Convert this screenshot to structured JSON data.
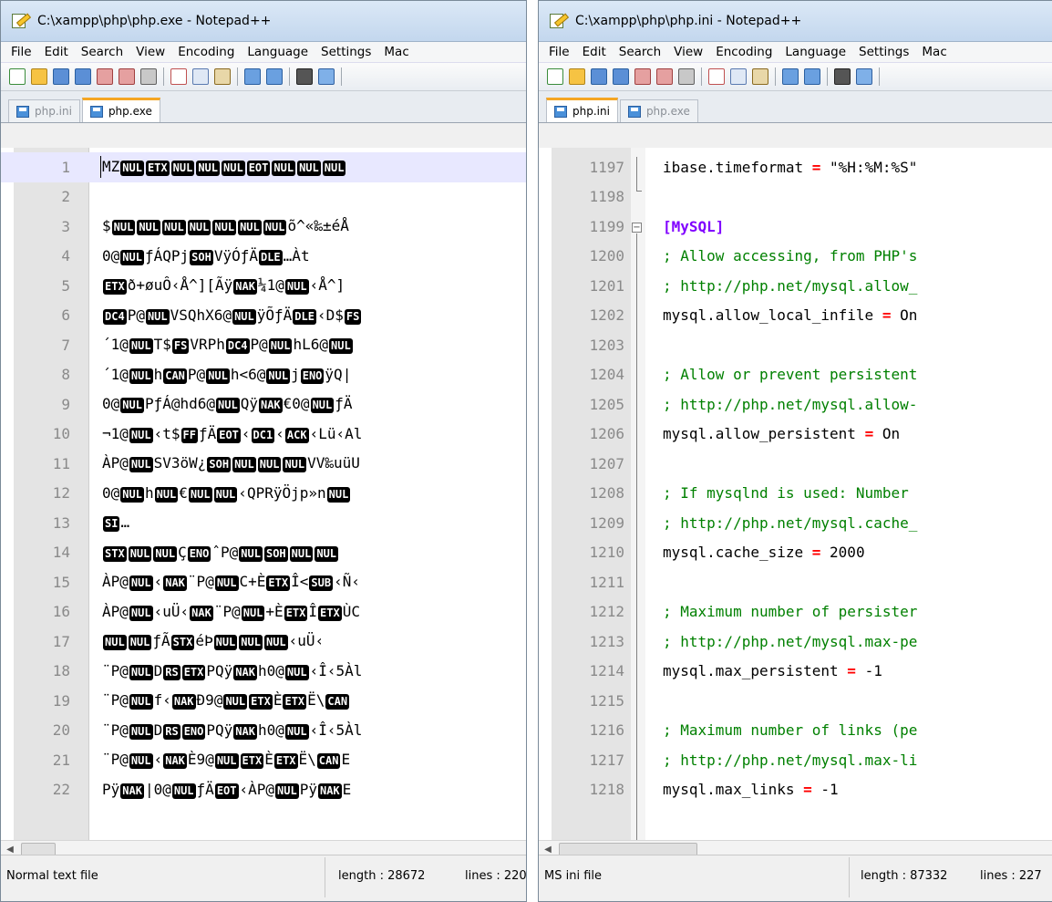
{
  "left": {
    "title": "C:\\xampp\\php\\php.exe - Notepad++",
    "menu": [
      "File",
      "Edit",
      "Search",
      "View",
      "Encoding",
      "Language",
      "Settings",
      "Mac"
    ],
    "tabs": [
      {
        "label": "php.ini",
        "active": false
      },
      {
        "label": "php.exe",
        "active": true
      }
    ],
    "lines": [
      {
        "n": "1",
        "text": "MZ NUL ETX NUL NUL NUL EOT NUL NUL NUL"
      },
      {
        "n": "2",
        "text": ""
      },
      {
        "n": "3",
        "text": "$ NUL NUL NUL NUL NUL NUL NUL õ^«‰±éÅ"
      },
      {
        "n": "4",
        "text": "0@ NUL ƒÁ QPj SOH VÿÓƒÄ DLE …Àt"
      },
      {
        "n": "5",
        "text": "ETX ð+øuÔ ‹Å^] [Ãÿ NAK ¼1@ NUL ‹Å^]"
      },
      {
        "n": "6",
        "text": "DC4 P@ NUL VSQhX6@ NUL ÿÕƒÄ DLE ‹D$ FS"
      },
      {
        "n": "7",
        "text": "´1@ NUL T$ FS VRPh DC4 P@ NUL hL6@ NUL"
      },
      {
        "n": "8",
        "text": "´1@ NUL h CAN P@ NUL h<6@ NUL j ENO ÿQ|"
      },
      {
        "n": "9",
        "text": "0@ NUL PƒÁ@hd6@ NUL Qÿ NAK €0@ NUL ƒÄ"
      },
      {
        "n": "10",
        "text": "¬1@ NUL ‹ t$ FF ƒÄ EOT ‹ DC1 ‹ ACK ‹ Lü‹ Al"
      },
      {
        "n": "11",
        "text": "ÀP@ NUL SV3öW¿ SOH NUL NUL NUL VV‰uüU"
      },
      {
        "n": "12",
        "text": "0@ NUL h NUL € NUL NUL ‹ QPRÿÖjp»n NUL"
      },
      {
        "n": "13",
        "text": "SI …"
      },
      {
        "n": "14",
        "text": "STX NUL NUL Ç ENO ˆP@ NUL SOH NUL NUL"
      },
      {
        "n": "15",
        "text": "ÀP@ NUL ‹ NAK ¨P@ NUL C+È ETX Î< SUB ‹ Ñ‹"
      },
      {
        "n": "16",
        "text": "ÀP@ NUL ‹ uÜ‹ NAK ¨P@ NUL +È ETX Î ETX ÙC"
      },
      {
        "n": "17",
        "text": "NUL NUL ƒÃ STX éÞ NUL NUL NUL ‹ uÜ‹"
      },
      {
        "n": "18",
        "text": "¨P@ NUL D RS ETX PQÿ NAK h0@ NUL ‹ Î‹ 5Àl"
      },
      {
        "n": "19",
        "text": "¨P@ NUL f‹ NAK Ð9@ NUL ETX È ETX Ë\\ CAN"
      },
      {
        "n": "20",
        "text": "¨P@ NUL D RS ENO PQÿ NAK h0@ NUL ‹ Î‹ 5Àl"
      },
      {
        "n": "21",
        "text": "¨P@ NUL ‹ NAK È9@ NUL ETX È ETX Ë\\ CAN E"
      },
      {
        "n": "22",
        "text": "Pÿ NAK |0@ NUL ƒÄ EOT ‹ÀP@ NUL Pÿ NAK E"
      }
    ],
    "status_type": "Normal text file",
    "status_length": "length : 28672",
    "status_lines": "lines : 220"
  },
  "right": {
    "title": "C:\\xampp\\php\\php.ini - Notepad++",
    "menu": [
      "File",
      "Edit",
      "Search",
      "View",
      "Encoding",
      "Language",
      "Settings",
      "Mac"
    ],
    "tabs": [
      {
        "label": "php.ini",
        "active": true
      },
      {
        "label": "php.exe",
        "active": false
      }
    ],
    "lines": [
      {
        "n": "1197",
        "text": "ibase.timeformat = \"%H:%M:%S\""
      },
      {
        "n": "1198",
        "text": ""
      },
      {
        "n": "1199",
        "text": "[MySQL]"
      },
      {
        "n": "1200",
        "text": "; Allow accessing, from PHP's"
      },
      {
        "n": "1201",
        "text": "; http://php.net/mysql.allow_"
      },
      {
        "n": "1202",
        "text": "mysql.allow_local_infile = On"
      },
      {
        "n": "1203",
        "text": ""
      },
      {
        "n": "1204",
        "text": "; Allow or prevent persistent"
      },
      {
        "n": "1205",
        "text": "; http://php.net/mysql.allow-"
      },
      {
        "n": "1206",
        "text": "mysql.allow_persistent = On"
      },
      {
        "n": "1207",
        "text": ""
      },
      {
        "n": "1208",
        "text": "; If mysqlnd is used: Number"
      },
      {
        "n": "1209",
        "text": "; http://php.net/mysql.cache_"
      },
      {
        "n": "1210",
        "text": "mysql.cache_size = 2000"
      },
      {
        "n": "1211",
        "text": ""
      },
      {
        "n": "1212",
        "text": "; Maximum number of persister"
      },
      {
        "n": "1213",
        "text": "; http://php.net/mysql.max-pe"
      },
      {
        "n": "1214",
        "text": "mysql.max_persistent = -1"
      },
      {
        "n": "1215",
        "text": ""
      },
      {
        "n": "1216",
        "text": "; Maximum number of links (pe"
      },
      {
        "n": "1217",
        "text": "; http://php.net/mysql.max-li"
      },
      {
        "n": "1218",
        "text": "mysql.max_links = -1"
      }
    ],
    "status_type": "MS ini file",
    "status_length": "length : 87332",
    "status_lines": "lines : 227"
  },
  "control_codes": [
    "NUL",
    "ETX",
    "EOT",
    "SOH",
    "DLE",
    "NAK",
    "DC4",
    "FS",
    "CAN",
    "ENO",
    "FF",
    "DC1",
    "ACK",
    "SI",
    "STX",
    "SUB",
    "RS"
  ],
  "colors": {
    "comment": "#008000",
    "section": "#8000ff",
    "operator": "#ff0000",
    "current_line": "#e8e8ff",
    "active_tab_accent": "#f5a623"
  }
}
